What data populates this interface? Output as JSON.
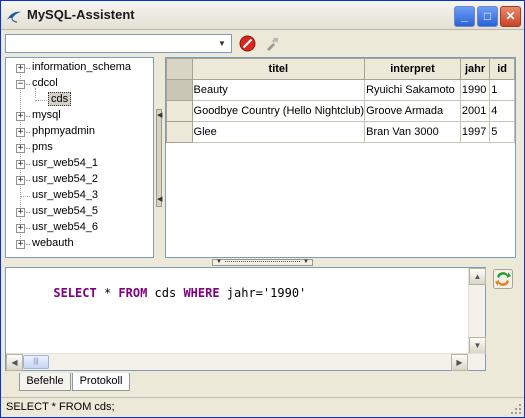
{
  "window": {
    "title": "MySQL-Assistent",
    "minimize_label": "_",
    "maximize_label": "□",
    "close_label": "✕"
  },
  "toolbar": {
    "database_select_value": "",
    "database_select_arrow": "▼"
  },
  "tree": {
    "items": [
      {
        "label": "information_schema",
        "expander": "+"
      },
      {
        "label": "cdcol",
        "expander": "−"
      },
      {
        "label": "cds",
        "expander": ""
      },
      {
        "label": "mysql",
        "expander": "+"
      },
      {
        "label": "phpmyadmin",
        "expander": "+"
      },
      {
        "label": "pms",
        "expander": "+"
      },
      {
        "label": "usr_web54_1",
        "expander": "+"
      },
      {
        "label": "usr_web54_2",
        "expander": "+"
      },
      {
        "label": "usr_web54_3",
        "expander": ""
      },
      {
        "label": "usr_web54_5",
        "expander": "+"
      },
      {
        "label": "usr_web54_6",
        "expander": "+"
      },
      {
        "label": "webauth",
        "expander": "+"
      }
    ],
    "selected": "cds"
  },
  "grid": {
    "columns": [
      "titel",
      "interpret",
      "jahr",
      "id"
    ],
    "rows": [
      [
        "Beauty",
        "Ryuichi Sakamoto",
        "1990",
        "1"
      ],
      [
        "Goodbye Country (Hello Nightclub)",
        "Groove Armada",
        "2001",
        "4"
      ],
      [
        "Glee",
        "Bran Van 3000",
        "1997",
        "5"
      ]
    ],
    "current_row": 0
  },
  "editor": {
    "sql_tokens": [
      {
        "text": "SELECT",
        "kind": "kw"
      },
      {
        "text": " * ",
        "kind": "txt"
      },
      {
        "text": "FROM",
        "kind": "kw"
      },
      {
        "text": " cds ",
        "kind": "txt"
      },
      {
        "text": "WHERE",
        "kind": "kw"
      },
      {
        "text": " jahr=",
        "kind": "txt"
      },
      {
        "text": "'1990'",
        "kind": "str"
      }
    ],
    "scroll_up": "▲",
    "scroll_down": "▼",
    "scroll_left": "◀",
    "scroll_right": "▶",
    "thumb_grip": "|||"
  },
  "tabs": {
    "befehle": "Befehle",
    "protokoll": "Protokoll",
    "active": "befehle"
  },
  "statusbar": {
    "text": "SELECT * FROM cds;"
  },
  "colors": {
    "keyword": "#800080",
    "selection_border": "#333333",
    "stop_red": "#d8261c",
    "exec_green": "#2e9a2e",
    "exec_orange": "#e6801e"
  },
  "icons": {
    "app": "dolphin-icon",
    "stop": "stop-icon",
    "tools": "tools-icon",
    "execute": "execute-icon"
  }
}
